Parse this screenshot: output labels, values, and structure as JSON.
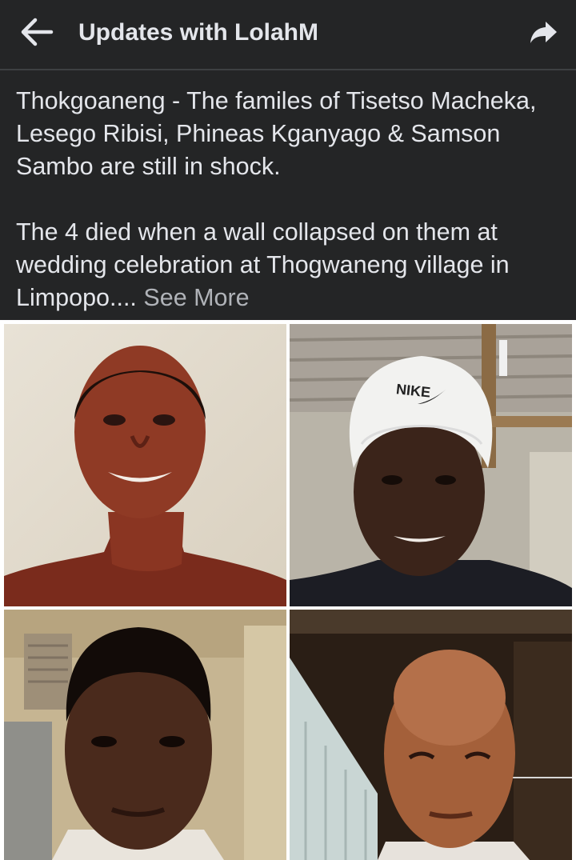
{
  "header": {
    "title": "Updates with LolahM",
    "back_icon": "arrow-left-icon",
    "share_icon": "share-arrow-icon"
  },
  "post": {
    "paragraph1": "Thokgoaneng - The familes of Tisetso Macheka, Lesego Ribisi, Phineas Kganyago & Samson Sambo are still in shock.",
    "paragraph2": " The 4 died when a wall collapsed on them at wedding celebration at Thogwaneng village in Limpopo....",
    "see_more": "See More"
  },
  "photos": [
    {
      "name": "photo-1"
    },
    {
      "name": "photo-2",
      "beanie_text": "NIKE"
    },
    {
      "name": "photo-3"
    },
    {
      "name": "photo-4"
    }
  ],
  "colors": {
    "bar_bg": "#242526",
    "text": "#e4e6eb",
    "muted": "#b0b3b8"
  }
}
